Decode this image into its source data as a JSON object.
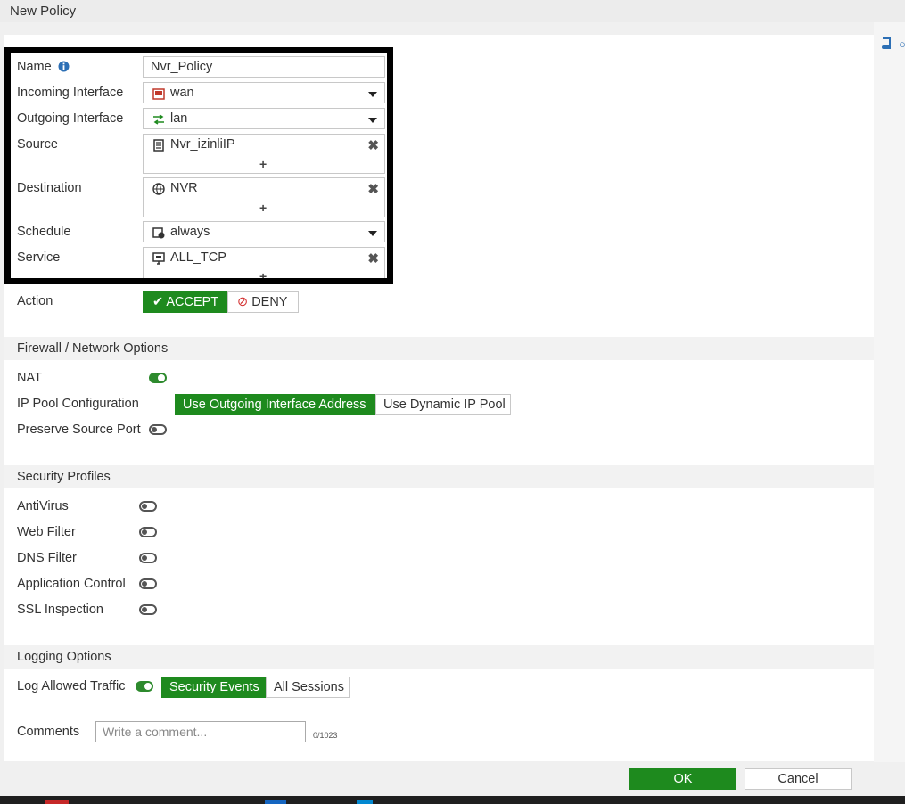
{
  "window": {
    "title": "New Policy"
  },
  "form": {
    "name": {
      "label": "Name",
      "value": "Nvr_Policy"
    },
    "incoming": {
      "label": "Incoming Interface",
      "value": "wan"
    },
    "outgoing": {
      "label": "Outgoing Interface",
      "value": "lan"
    },
    "source": {
      "label": "Source",
      "value": "Nvr_izinliIP"
    },
    "destination": {
      "label": "Destination",
      "value": "NVR"
    },
    "schedule": {
      "label": "Schedule",
      "value": "always"
    },
    "service": {
      "label": "Service",
      "value": "ALL_TCP"
    },
    "action": {
      "label": "Action",
      "accept": "ACCEPT",
      "deny": "DENY",
      "selected": "ACCEPT"
    }
  },
  "firewall": {
    "title": "Firewall / Network Options",
    "nat_label": "NAT",
    "nat_enabled": true,
    "ip_pool_label": "IP Pool Configuration",
    "ip_pool_options": [
      "Use Outgoing Interface Address",
      "Use Dynamic IP Pool"
    ],
    "ip_pool_selected": "Use Outgoing Interface Address",
    "preserve_label": "Preserve Source Port",
    "preserve_enabled": false
  },
  "security": {
    "title": "Security Profiles",
    "profiles": [
      {
        "label": "AntiVirus",
        "enabled": false
      },
      {
        "label": "Web Filter",
        "enabled": false
      },
      {
        "label": "DNS Filter",
        "enabled": false
      },
      {
        "label": "Application Control",
        "enabled": false
      },
      {
        "label": "SSL Inspection",
        "enabled": false
      }
    ]
  },
  "logging": {
    "title": "Logging Options",
    "log_label": "Log Allowed Traffic",
    "log_enabled": true,
    "options": [
      "Security Events",
      "All Sessions"
    ],
    "selected": "Security Events"
  },
  "comments": {
    "label": "Comments",
    "placeholder": "Write a comment...",
    "counter": "0/1023"
  },
  "buttons": {
    "ok": "OK",
    "cancel": "Cancel"
  },
  "colors": {
    "accent": "#1e8a1e",
    "highlight_border": "#000000",
    "interface_icon": "#c0392b"
  },
  "icons": {
    "name_info": "info-icon",
    "wan": "port-icon",
    "lan": "swap-arrows-icon",
    "source": "address-icon",
    "destination": "globe-icon",
    "schedule": "calendar-clock-icon",
    "service": "service-icon",
    "remove": "close-icon",
    "add": "plus-icon",
    "accept": "check-icon",
    "deny": "ban-icon",
    "help": "book-icon"
  }
}
